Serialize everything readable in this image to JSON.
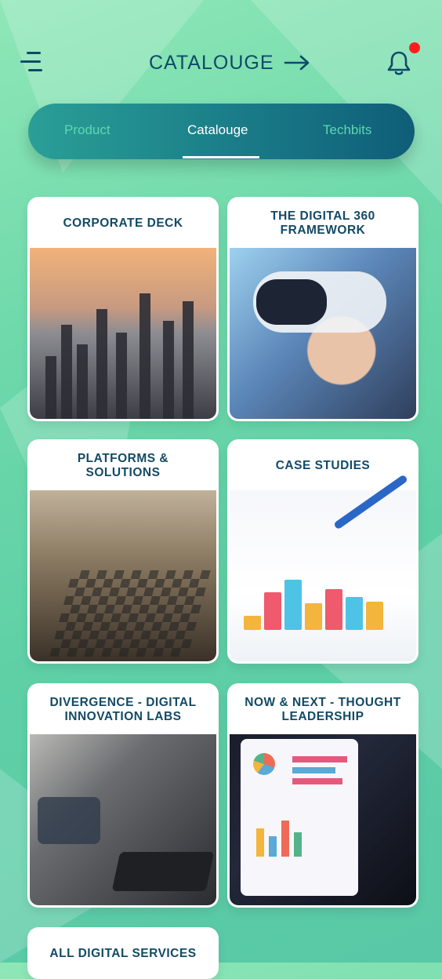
{
  "header": {
    "title": "CATALOUGE",
    "menu_icon": "menu-icon",
    "arrow_icon": "arrow-right-icon",
    "bell_icon": "bell-icon",
    "notification_dot_color": "#ff1e1e"
  },
  "tabs": {
    "items": [
      {
        "label": "Product",
        "active": false
      },
      {
        "label": "Catalouge",
        "active": true
      },
      {
        "label": "Techbits",
        "active": false
      }
    ]
  },
  "cards": [
    {
      "title": "CORPORATE DECK",
      "image": "city-skyline"
    },
    {
      "title": "THE DIGITAL 360 FRAMEWORK",
      "image": "vr-headset"
    },
    {
      "title": "PLATFORMS & SOLUTIONS",
      "image": "chess-board"
    },
    {
      "title": "CASE STUDIES",
      "image": "chart-with-pen"
    },
    {
      "title": "DIVERGENCE - DIGITAL INNOVATION LABS",
      "image": "office-laptop"
    },
    {
      "title": "NOW & NEXT - THOUGHT LEADERSHIP",
      "image": "tablet-charts"
    },
    {
      "title": "ALL DIGITAL SERVICES",
      "image": "partial-card"
    }
  ],
  "colors": {
    "accent_dark": "#0f4a66",
    "tab_active": "#ffffff",
    "tab_inactive": "#5ed7b0"
  }
}
